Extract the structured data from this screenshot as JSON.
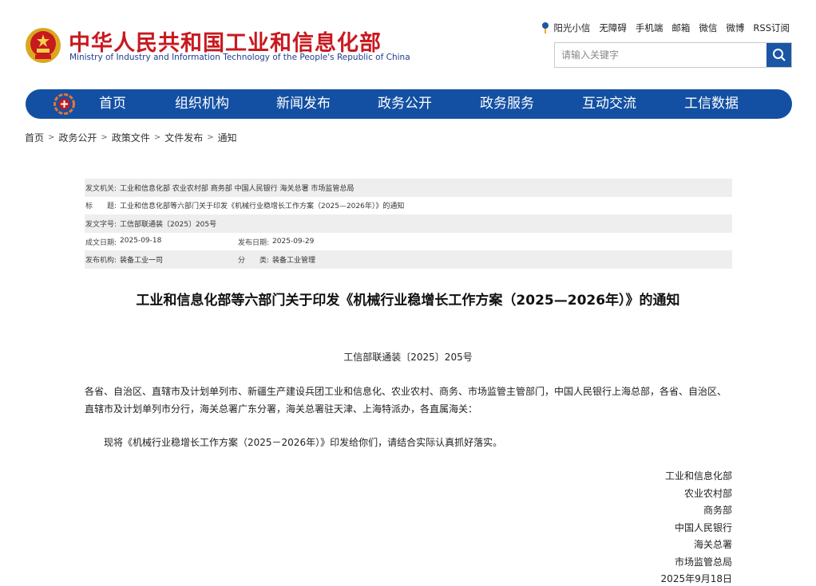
{
  "header": {
    "title": "中华人民共和国工业和信息化部",
    "subtitle": "Ministry of Industry and Information Technology of the People's Republic of China",
    "top_links": [
      "阳光小信",
      "无障碍",
      "手机端",
      "邮箱",
      "微信",
      "微博",
      "RSS订阅"
    ],
    "search": {
      "placeholder": "请输入关键字"
    },
    "colors": {
      "title_red": "#c8191f",
      "nav_blue": "#1350a3"
    }
  },
  "nav": {
    "items": [
      "首页",
      "组织机构",
      "新闻发布",
      "政务公开",
      "政务服务",
      "互动交流",
      "工信数据"
    ]
  },
  "breadcrumb": [
    "首页",
    "政务公开",
    "政策文件",
    "文件发布",
    "通知"
  ],
  "meta": {
    "issuer_label": "发文机关:",
    "issuer_value": "工业和信息化部 农业农村部 商务部 中国人民银行 海关总署 市场监管总局",
    "title_label": "标　　题:",
    "title_value": "工业和信息化部等六部门关于印发《机械行业稳增长工作方案（2025—2026年）》的通知",
    "docno_label": "发文字号:",
    "docno_value": "工信部联通装〔2025〕205号",
    "written_label": "成文日期:",
    "written_value": "2025-09-18",
    "published_label": "发布日期:",
    "published_value": "2025-09-29",
    "org_label": "发布机构:",
    "org_value": "装备工业一司",
    "category_label": "分　　类:",
    "category_value": "装备工业管理"
  },
  "article": {
    "title": "工业和信息化部等六部门关于印发《机械行业稳增长工作方案（2025—2026年）》的通知",
    "doc_number": "工信部联通装〔2025〕205号",
    "para1": "各省、自治区、直辖市及计划单列市、新疆生产建设兵团工业和信息化、农业农村、商务、市场监管主管部门，中国人民银行上海总部，各省、自治区、直辖市及计划单列市分行，海关总署广东分署，海关总署驻天津、上海特派办，各直属海关：",
    "para2": "现将《机械行业稳增长工作方案（2025－2026年）》印发给你们，请结合实际认真抓好落实。",
    "signers": [
      "工业和信息化部",
      "农业农村部",
      "商务部",
      "中国人民银行",
      "海关总署",
      "市场监管总局",
      "2025年9月18日"
    ]
  }
}
